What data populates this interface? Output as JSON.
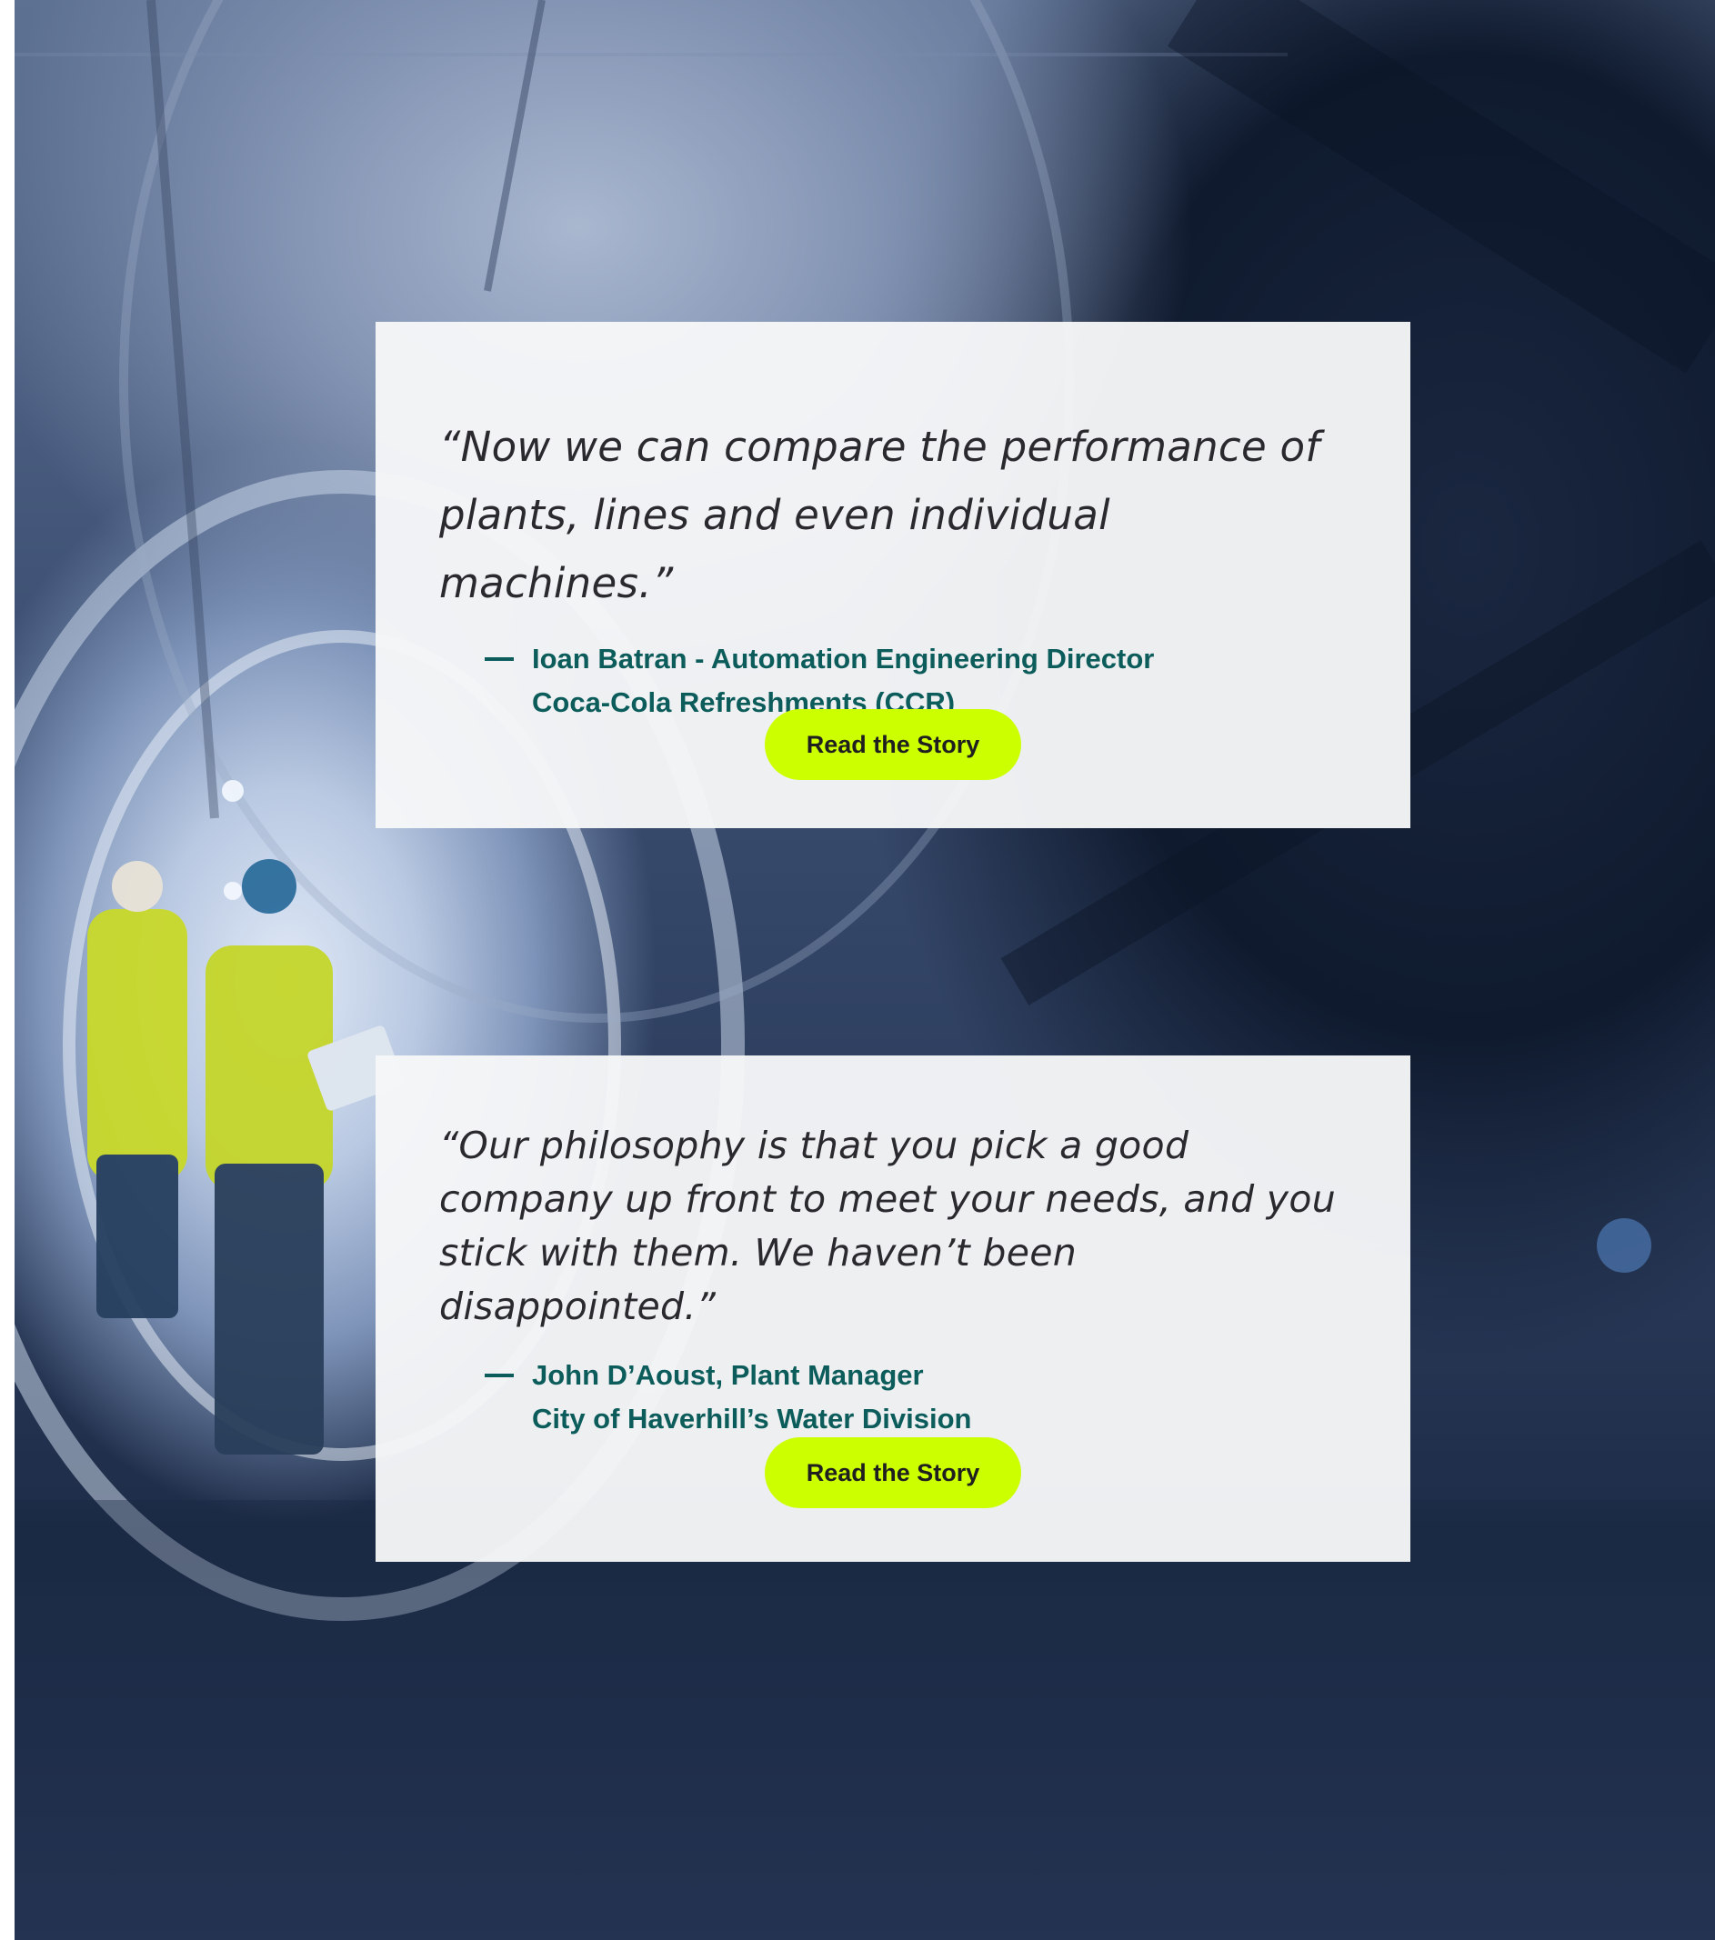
{
  "testimonials": [
    {
      "quote": "“Now we can compare the performance of plants, lines and even individual machines.”",
      "attribution_line1": "Ioan Batran - Automation Engineering Director",
      "attribution_line2": "Coca-Cola Refreshments (CCR)",
      "button_label": "Read the Story"
    },
    {
      "quote": "“Our philosophy is that you pick a good company up front to meet your needs, and you stick with them. We haven’t been disappointed.”",
      "attribution_line1": "John D’Aoust, Plant Manager",
      "attribution_line2": "City of Haverhill’s Water Division",
      "button_label": "Read the Story"
    }
  ],
  "colors": {
    "accent_button": "#ccff00",
    "attribution_text": "#0b5c5a",
    "quote_text": "#2a2a2e",
    "card_background": "#f6f7f8"
  },
  "background": {
    "description_icon": "industrial-pipe-photo"
  }
}
